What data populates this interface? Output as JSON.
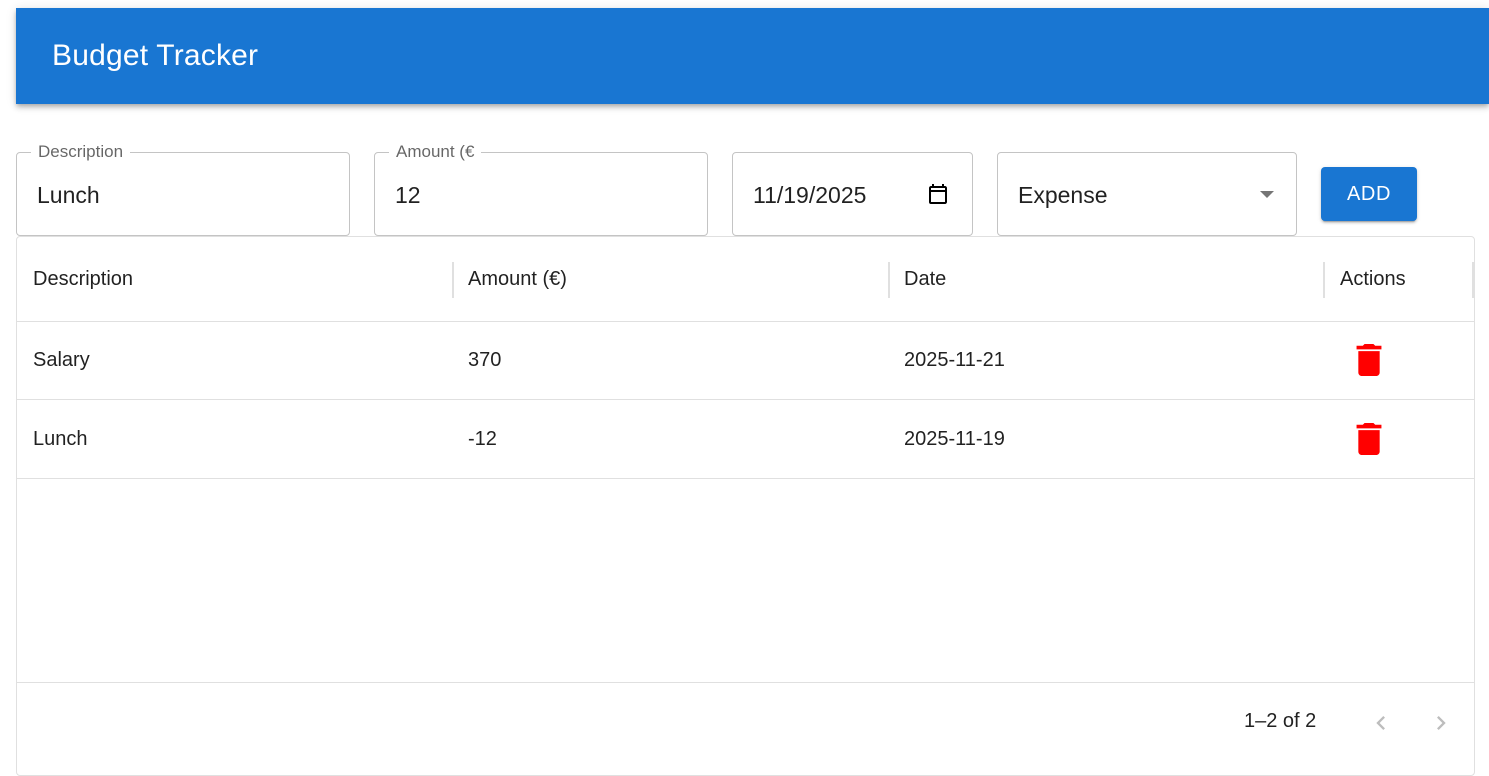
{
  "app": {
    "title": "Budget Tracker"
  },
  "form": {
    "description": {
      "label": "Description",
      "value": "Lunch"
    },
    "amount": {
      "label": "Amount (€",
      "value": "12"
    },
    "date": {
      "value": "11/19/2025",
      "icon": "calendar-icon"
    },
    "type": {
      "value": "Expense",
      "icon": "dropdown-arrow-icon"
    },
    "add_label": "ADD"
  },
  "grid": {
    "columns": [
      "Description",
      "Amount (€)",
      "Date",
      "Actions"
    ],
    "rows": [
      {
        "description": "Salary",
        "amount": "370",
        "date": "2025-11-21"
      },
      {
        "description": "Lunch",
        "amount": "-12",
        "date": "2025-11-19"
      }
    ],
    "pagination": "1–2 of 2"
  },
  "colors": {
    "primary": "#1976d2",
    "delete": "#ff0000"
  }
}
